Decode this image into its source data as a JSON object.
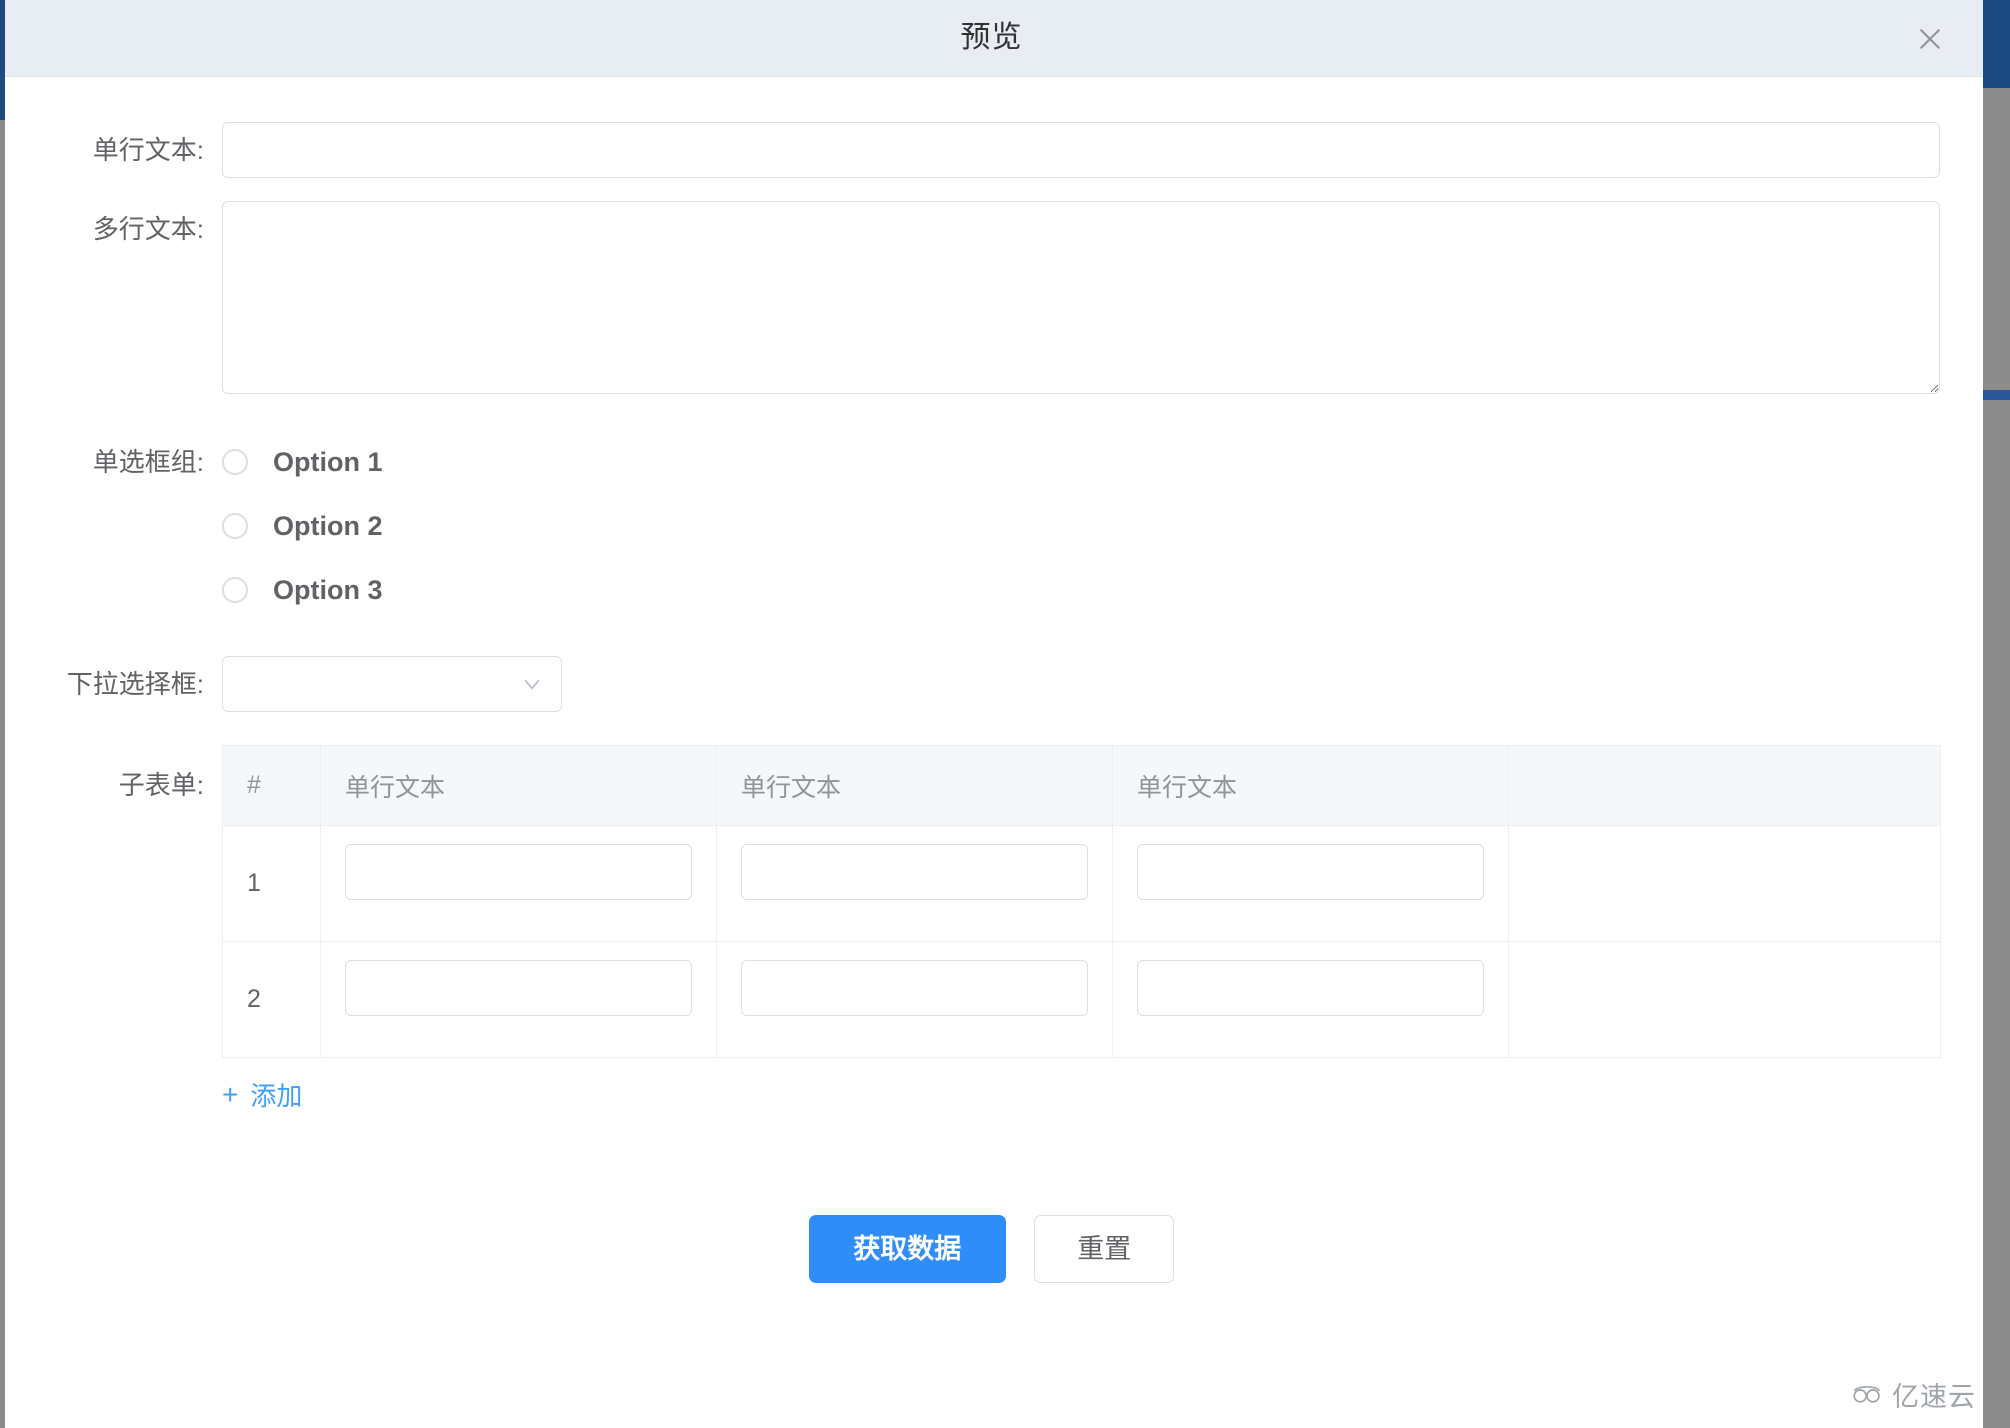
{
  "dialog": {
    "title": "预览",
    "close_icon": "close-icon"
  },
  "form": {
    "rows": [
      {
        "label": "单行文本:",
        "type": "input",
        "value": "",
        "placeholder": ""
      },
      {
        "label": "多行文本:",
        "type": "textarea",
        "value": "",
        "placeholder": ""
      },
      {
        "label": "单选框组:",
        "type": "radio-group"
      },
      {
        "label": "下拉选择框:",
        "type": "select"
      },
      {
        "label": "子表单:",
        "type": "subform"
      }
    ],
    "single_line_label": "单行文本:",
    "multi_line_label": "多行文本:",
    "radio_group_label": "单选框组:",
    "select_label": "下拉选择框:",
    "subform_label": "子表单:"
  },
  "radio_group": {
    "selected": null,
    "options": [
      {
        "label": "Option 1",
        "value": "1",
        "checked": false
      },
      {
        "label": "Option 2",
        "value": "2",
        "checked": false
      },
      {
        "label": "Option 3",
        "value": "3",
        "checked": false
      }
    ]
  },
  "select": {
    "value": "",
    "placeholder": "",
    "arrow_icon": "chevron-down-icon",
    "options": []
  },
  "subform": {
    "columns": [
      "#",
      "单行文本",
      "单行文本",
      "单行文本",
      ""
    ],
    "rows": [
      {
        "index": "1",
        "cells": [
          "",
          "",
          ""
        ]
      },
      {
        "index": "2",
        "cells": [
          "",
          "",
          ""
        ]
      }
    ],
    "add_label": "添加",
    "add_icon": "plus-icon"
  },
  "footer": {
    "submit_label": "获取数据",
    "reset_label": "重置"
  },
  "watermark": {
    "text": "亿速云",
    "icon": "cloud-icon"
  },
  "colors": {
    "titlebar_bg": "#e8edf4",
    "primary": "#2f8dfa",
    "link": "#409eff",
    "border": "#dcdfe6",
    "table_header_bg": "#f5f7fa",
    "table_border": "#ebeef5",
    "text": "#606266",
    "rail_blue": "#1d4a80"
  }
}
